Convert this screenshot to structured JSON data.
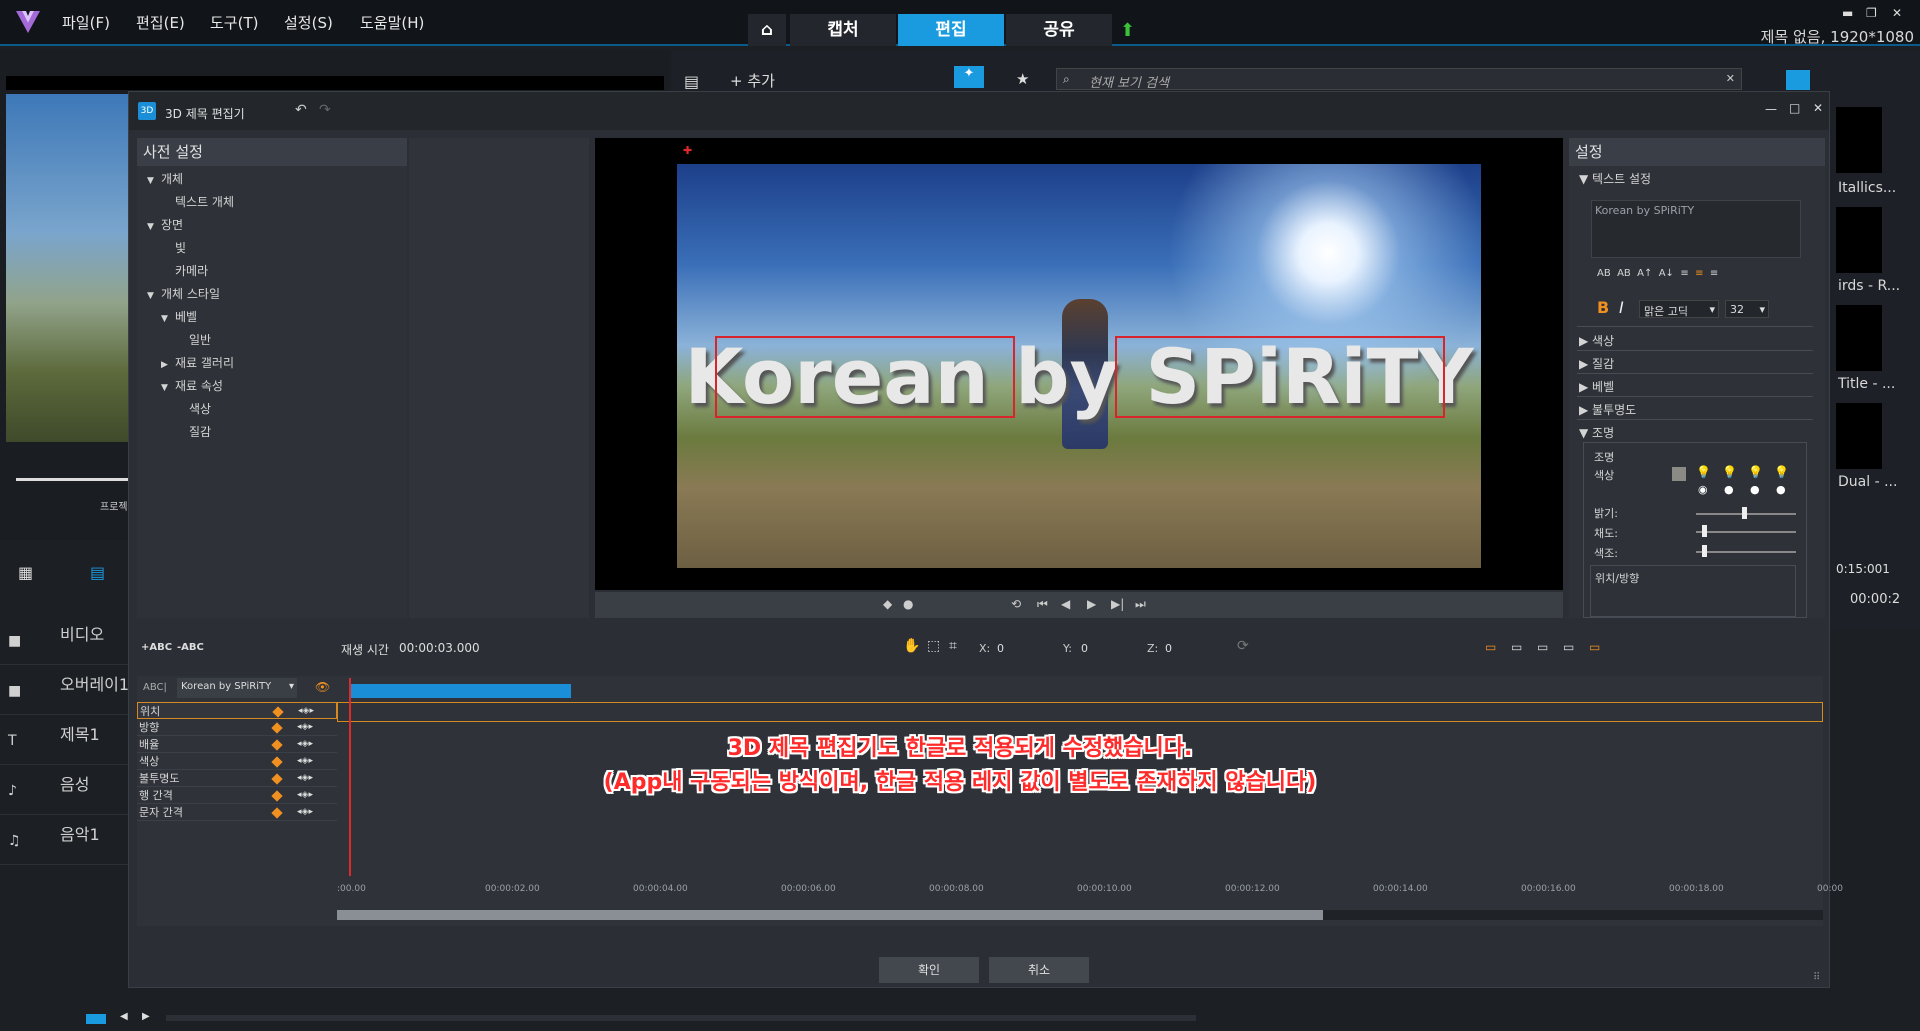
{
  "menu": {
    "items": [
      "파일(F)",
      "편집(E)",
      "도구(T)",
      "설정(S)",
      "도움말(H)"
    ],
    "tabs": [
      "캡처",
      "편집",
      "공유"
    ],
    "title_right": "제목 없음, 1920*1080"
  },
  "library": {
    "add_label": "추가",
    "search_placeholder": "현재 보기 검색",
    "thumbs": [
      "Itallics...",
      "irds - R...",
      "Title - ...",
      "Dual - ..."
    ],
    "timecode_1": "0:15:001",
    "timecode_2": "00:00:2"
  },
  "left_panel": {
    "project_label": "프로젝",
    "tracks": [
      "비디오",
      "오버레이1",
      "제목1",
      "음성",
      "음악1"
    ]
  },
  "dialog": {
    "title": "3D 제목 편집기",
    "icon_label": "3D",
    "preset_header": "사전 설정",
    "tree": [
      {
        "label": "개체",
        "level": 0,
        "arrow": "▼"
      },
      {
        "label": "텍스트 개체",
        "level": 1,
        "arrow": ""
      },
      {
        "label": "장면",
        "level": 0,
        "arrow": "▼"
      },
      {
        "label": "빛",
        "level": 1,
        "arrow": ""
      },
      {
        "label": "카메라",
        "level": 1,
        "arrow": ""
      },
      {
        "label": "개체 스타일",
        "level": 0,
        "arrow": "▼"
      },
      {
        "label": "베벨",
        "level": 1,
        "arrow": "▼"
      },
      {
        "label": "일반",
        "level": 2,
        "arrow": ""
      },
      {
        "label": "재료 갤러리",
        "level": 1,
        "arrow": "▶"
      },
      {
        "label": "재료 속성",
        "level": 1,
        "arrow": "▼"
      },
      {
        "label": "색상",
        "level": 2,
        "arrow": ""
      },
      {
        "label": "질감",
        "level": 2,
        "arrow": ""
      }
    ],
    "preview_text": "Korean by SPiRiTY",
    "settings": {
      "header": "설정",
      "text_settings": "텍스트 설정",
      "text_value": "Korean by SPiRiTY",
      "font": "맑은 고딕",
      "size": "32",
      "sections": [
        "색상",
        "질감",
        "베벨",
        "불투명도",
        "조명"
      ],
      "lighting_label": "조명",
      "color_label": "색상",
      "brightness": "밝기:",
      "saturation": "채도:",
      "hue": "색조:",
      "position_dir": "위치/방향",
      "text_buttons": [
        "AB",
        "AB",
        "A↑",
        "A↓"
      ],
      "bold": "B",
      "italic": "I"
    },
    "timeline": {
      "add_abc": "+ABC",
      "remove_abc": "-ABC",
      "playtime_label": "재생 시간",
      "playtime_value": "00:00:03.000",
      "x_label": "X:",
      "x_value": "0",
      "y_label": "Y:",
      "y_value": "0",
      "z_label": "Z:",
      "z_value": "0",
      "object_select": "Korean by SPiRiTY",
      "object_prefix": "ABC|",
      "rows": [
        "위치",
        "방향",
        "배율",
        "색상",
        "불투명도",
        "행 간격",
        "문자 간격"
      ],
      "ruler": [
        ":00.00",
        "00:00:02.00",
        "00:00:04.00",
        "00:00:06.00",
        "00:00:08.00",
        "00:00:10.00",
        "00:00:12.00",
        "00:00:14.00",
        "00:00:16.00",
        "00:00:18.00",
        "00:00"
      ]
    },
    "ok_label": "확인",
    "cancel_label": "취소"
  },
  "notice": {
    "line1": "3D 제목 편집기도 한글로 적용되게 수정했습니다.",
    "line2": "(App내 구동되는 방식이며, 한글 적용 레지 값이 별도로 존재하지 않습니다)"
  },
  "colors": {
    "accent": "#1a9be0",
    "keyframe": "#f09020",
    "notice": "#ff2a2a"
  }
}
